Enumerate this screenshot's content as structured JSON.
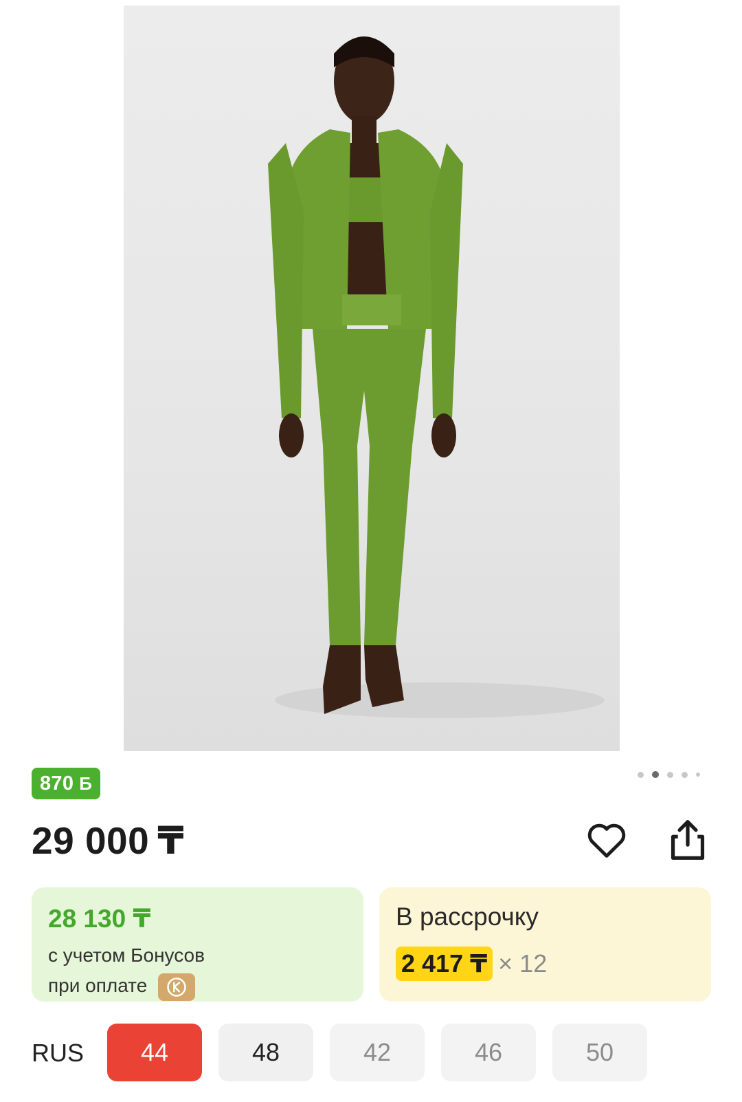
{
  "bonus_badge": {
    "amount": "870",
    "symbol": "Б"
  },
  "carousel": {
    "total": 5,
    "active": 1
  },
  "price": {
    "value": "29 000",
    "currency": "₸"
  },
  "actions": {
    "favorite_icon": "heart-icon",
    "share_icon": "share-icon"
  },
  "bonus_card": {
    "price": "28 130 ₸",
    "line1": "с учетом Бонусов",
    "line2": "при оплате"
  },
  "installment_card": {
    "title": "В рассрочку",
    "amount": "2 417 ₸",
    "multiplier": "× 12"
  },
  "sizes": {
    "label": "RUS",
    "options": [
      {
        "label": "44",
        "state": "selected"
      },
      {
        "label": "48",
        "state": "available"
      },
      {
        "label": "42",
        "state": "unavailable"
      },
      {
        "label": "46",
        "state": "unavailable"
      },
      {
        "label": "50",
        "state": "unavailable"
      }
    ]
  },
  "colors": {
    "accent_green": "#4cb02f",
    "bonus_card_bg": "#e6f6d9",
    "installment_bg": "#fdf6d6",
    "installment_highlight": "#ffd516",
    "selected_size": "#ea4234"
  }
}
